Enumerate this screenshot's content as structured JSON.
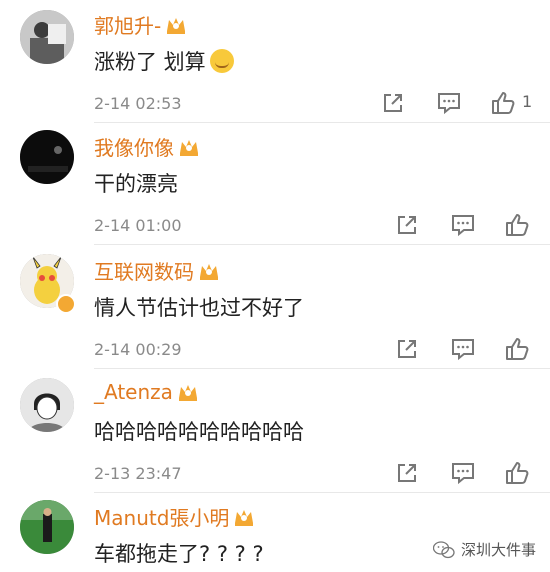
{
  "comments": [
    {
      "username": "郭旭升-",
      "text": "涨粉了 划算",
      "time": "2-14 02:53",
      "likes": "1",
      "emoji": "clapping-emoji"
    },
    {
      "username": "我像你像",
      "text": "干的漂亮",
      "time": "2-14 01:00",
      "likes": ""
    },
    {
      "username": "互联网数码",
      "text": "情人节估计也过不好了",
      "time": "2-14 00:29",
      "likes": ""
    },
    {
      "username": "_Atenza",
      "text": "哈哈哈哈哈哈哈哈哈哈",
      "time": "2-13 23:47",
      "likes": ""
    },
    {
      "username": "Manutd張小明",
      "text": "车都拖走了? ? ? ?",
      "time": "",
      "likes": ""
    }
  ],
  "watermark": {
    "label": "深圳大件事"
  },
  "colors": {
    "username": "#e07a21",
    "timestamp": "#8a8a8a",
    "icon": "#777777",
    "crown": "#f3a833"
  },
  "icons": {
    "action_1": "share-icon",
    "action_2": "reply-icon",
    "action_3": "like-icon",
    "badge": "vip-crown-icon"
  }
}
